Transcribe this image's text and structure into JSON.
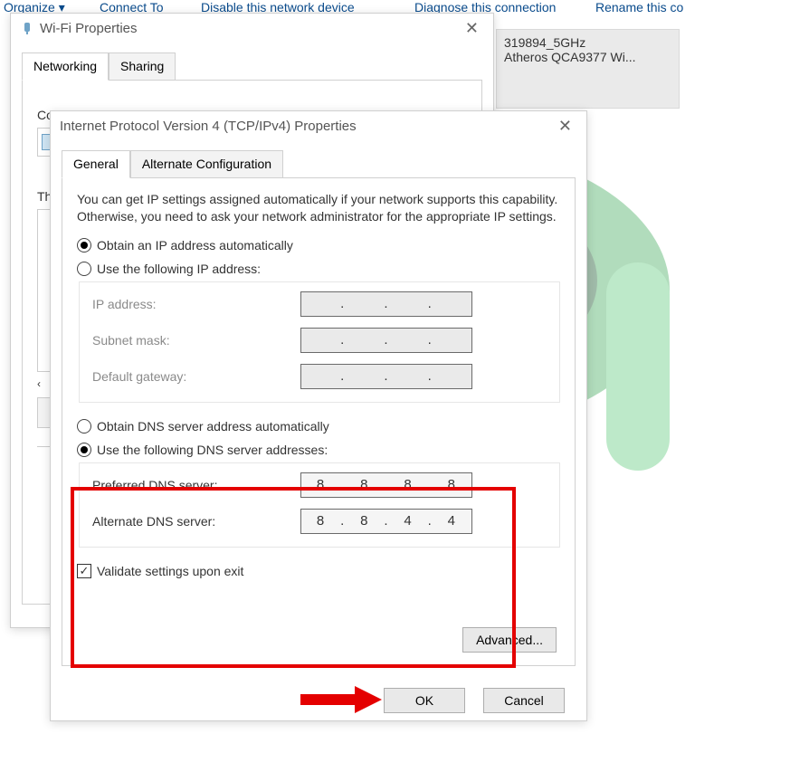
{
  "toolbar": {
    "organize": "Organize ▾",
    "connect_to": "Connect To",
    "disable": "Disable this network device",
    "diagnose": "Diagnose this connection",
    "rename": "Rename this co"
  },
  "network_card": {
    "line1": "319894_5GHz",
    "line2": "Atheros QCA9377 Wi..."
  },
  "wifi_dialog": {
    "title": "Wi-Fi Properties",
    "tabs": [
      "Networking",
      "Sharing"
    ],
    "connect_label": "Connect using:",
    "th_label": "Th",
    "scroll_left": "‹"
  },
  "ipv4_dialog": {
    "title": "Internet Protocol Version 4 (TCP/IPv4) Properties",
    "tabs": [
      "General",
      "Alternate Configuration"
    ],
    "description": "You can get IP settings assigned automatically if your network supports this capability. Otherwise, you need to ask your network administrator for the appropriate IP settings.",
    "ip_auto": "Obtain an IP address automatically",
    "ip_manual": "Use the following IP address:",
    "ip_address_lbl": "IP address:",
    "subnet_lbl": "Subnet mask:",
    "gateway_lbl": "Default gateway:",
    "dns_auto": "Obtain DNS server address automatically",
    "dns_manual": "Use the following DNS server addresses:",
    "pref_dns_lbl": "Preferred DNS server:",
    "alt_dns_lbl": "Alternate DNS server:",
    "pref_dns": {
      "a": "8",
      "b": "8",
      "c": "8",
      "d": "8"
    },
    "alt_dns": {
      "a": "8",
      "b": "8",
      "c": "4",
      "d": "4"
    },
    "validate": "Validate settings upon exit",
    "advanced": "Advanced...",
    "ok": "OK",
    "cancel": "Cancel"
  }
}
